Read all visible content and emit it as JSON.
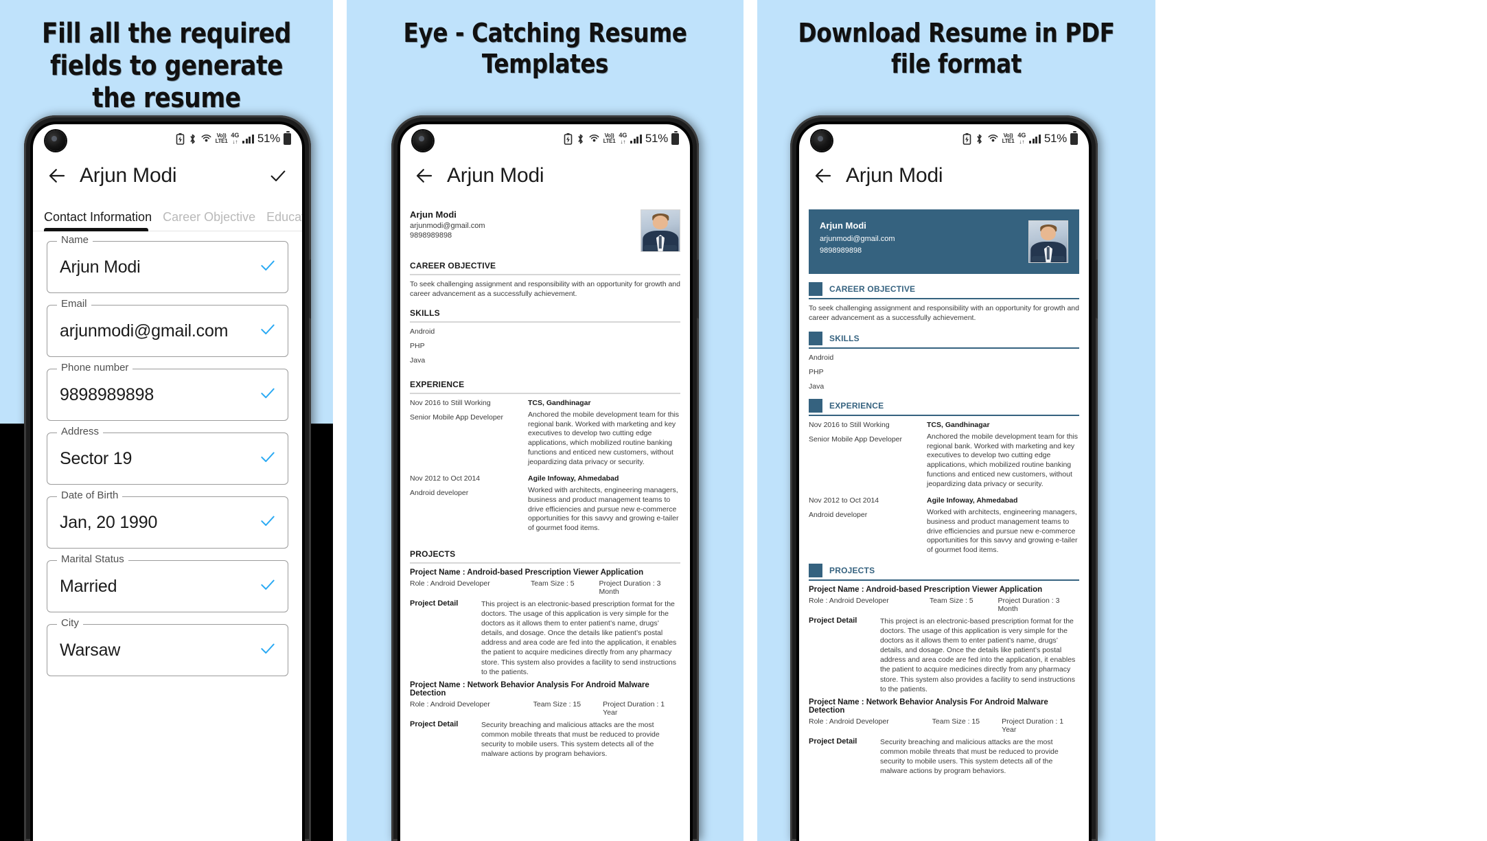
{
  "theme": {
    "panel_bg": "#bfe2fb",
    "headline_color": "#111111",
    "accent_navy": "#35627f",
    "tick_blue": "#29a9f3"
  },
  "panels": [
    {
      "headline": "Fill all the required fields to generate the resume"
    },
    {
      "headline": "Eye - Catching Resume Templates"
    },
    {
      "headline": "Download Resume in PDF file format"
    }
  ],
  "status_bar": {
    "battery_saver_icon": "battery-saver-icon",
    "bluetooth_icon": "bluetooth-icon",
    "hotspot_icon": "hotspot-icon",
    "volte_line1": "Vo))",
    "volte_line2": "LTE1",
    "network_type": "4G",
    "data_arrows": "↓↑",
    "signal_icon": "signal-bars-icon",
    "battery_percent": "51%",
    "battery_icon": "battery-icon"
  },
  "app_bar": {
    "back_icon": "back-arrow-icon",
    "title": "Arjun Modi",
    "done_icon": "check-icon"
  },
  "tabs": [
    {
      "label": "Contact Information",
      "active": true
    },
    {
      "label": "Career Objective",
      "active": false
    },
    {
      "label": "Education Q",
      "active": false
    }
  ],
  "form_fields": [
    {
      "label": "Name",
      "value": "Arjun Modi",
      "valid_icon": "check-icon"
    },
    {
      "label": "Email",
      "value": "arjunmodi@gmail.com",
      "valid_icon": "check-icon"
    },
    {
      "label": "Phone number",
      "value": "9898989898",
      "valid_icon": "check-icon"
    },
    {
      "label": "Address",
      "value": "Sector 19",
      "valid_icon": "check-icon"
    },
    {
      "label": "Date of Birth",
      "value": "Jan, 20 1990",
      "valid_icon": "check-icon"
    },
    {
      "label": "Marital Status",
      "value": "Married",
      "valid_icon": "check-icon"
    },
    {
      "label": "City",
      "value": "Warsaw",
      "valid_icon": "check-icon"
    }
  ],
  "resume": {
    "name": "Arjun Modi",
    "email": "arjunmodi@gmail.com",
    "phone": "9898989898",
    "photo_icon": "profile-photo",
    "sections": {
      "objective_title": "CAREER OBJECTIVE",
      "objective_text": "To seek challenging assignment and responsibility with an opportunity for growth and career advancement as a successfully achievement.",
      "skills_title": "SKILLS",
      "skills": [
        "Android",
        "PHP",
        "Java"
      ],
      "experience_title": "EXPERIENCE",
      "projects_title": "PROJECTS"
    },
    "experience": [
      {
        "period": "Nov 2016 to Still Working",
        "role": "Senior Mobile App Developer",
        "company": "TCS, Gandhinagar",
        "description": "Anchored the mobile development team for this regional bank. Worked with marketing and key executives to develop two cutting edge applications, which mobilized routine banking functions and enticed new customers, without jeopardizing data privacy or security."
      },
      {
        "period": "Nov 2012 to Oct 2014",
        "role": "Android developer",
        "company": "Agile Infoway, Ahmedabad",
        "description": "Worked with architects, engineering managers, business and product management teams to drive efficiencies and pursue new e-commerce opportunities for this savvy and growing e-tailer of gourmet food items."
      }
    ],
    "projects": [
      {
        "name": "Project Name : Android-based Prescription Viewer Application",
        "role": "Role : Android Developer",
        "team_size": "Team Size : 5",
        "duration": "Project Duration : 3 Month",
        "detail_label": "Project Detail",
        "detail": "This project is an electronic-based prescription format for the doctors. The usage of this application is very simple for the doctors as it allows them to enter patient’s name, drugs’ details, and dosage. Once the details like patient’s postal address and area code are fed into the application, it enables the patient to acquire medicines directly from any pharmacy store. This system also provides a facility to send instructions to the patients."
      },
      {
        "name": "Project Name : Network Behavior Analysis For Android Malware Detection",
        "role": "Role : Android Developer",
        "team_size": "Team Size : 15",
        "duration": "Project Duration : 1 Year",
        "detail_label": "Project Detail",
        "detail": "Security breaching and malicious attacks are the most common mobile threats that must be reduced to provide security to mobile users. This system detects all of the malware actions by program behaviors."
      }
    ]
  }
}
